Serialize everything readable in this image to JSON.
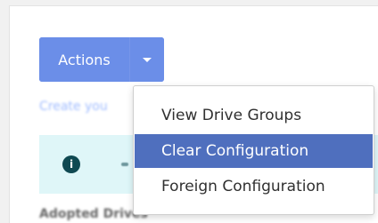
{
  "actions": {
    "label": "Actions",
    "dropdown_icon": "caret-down-icon"
  },
  "background": {
    "helper_text": "Create you",
    "info_icon": "info-icon",
    "info_symbol": "i",
    "section_heading": "Adopted Drives"
  },
  "menu": {
    "items": [
      {
        "label": "View Drive Groups",
        "selected": false
      },
      {
        "label": "Clear Configuration",
        "selected": true
      },
      {
        "label": "Foreign Configuration",
        "selected": false
      }
    ]
  },
  "colors": {
    "button": "#6b8ee8",
    "selection": "#4f6fbe",
    "info_bg": "#dff6f8",
    "info_icon": "#0f4952"
  }
}
